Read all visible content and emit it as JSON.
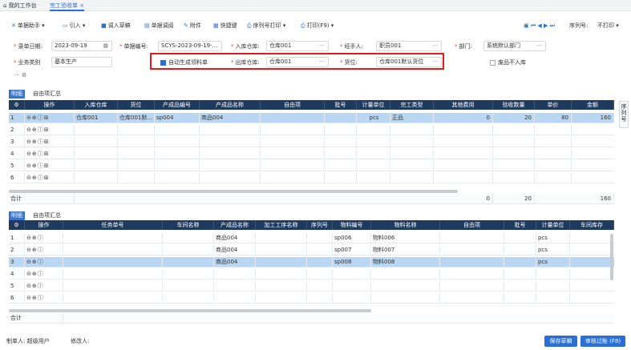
{
  "tabs": [
    {
      "label": "我的工作台"
    },
    {
      "label": "完工验收单"
    }
  ],
  "toolbar": {
    "doc_assist": "单据助手",
    "import": "引入",
    "draft": "调入草稿",
    "query": "单据调阅",
    "attach": "附件",
    "shortcut": "快捷键",
    "serial_print": "序列号打印",
    "print": "打印(F9)",
    "serial_no": "序列号:",
    "print_state": "不打印"
  },
  "form": {
    "date_label": "录单日期:",
    "date_value": "2023-09-19",
    "no_label": "单据编号:",
    "no_value": "SCYS-2023-09-19-...",
    "in_wh_label": "入库仓库:",
    "in_wh_value": "仓库001",
    "handler_label": "经手人:",
    "handler_value": "职员001",
    "dept_label": "部门:",
    "dept_value": "系统默认部门",
    "biz_label": "业务类别",
    "biz_value": "基本生产",
    "auto_label": "自动生成领料单",
    "out_wh_label": "出库仓库:",
    "out_wh_value": "仓库001",
    "pos_label": "货位:",
    "pos_value": "仓库001默认货位",
    "scrap_label": "废品不入库"
  },
  "grid1": {
    "tabs": [
      "明细",
      "自由项汇总"
    ],
    "headers": [
      "操作",
      "入库仓库",
      "货位",
      "产成品编号",
      "产成品名称",
      "自由项",
      "批号",
      "计量单位",
      "完工类型",
      "其他费用",
      "验收数量",
      "单价",
      "金额"
    ],
    "rows": [
      {
        "no": "1",
        "wh": "仓库001",
        "pos": "仓库001默...",
        "code": "sp004",
        "name": "商品004",
        "unit": "pcs",
        "type": "正品",
        "fee": "0",
        "qty": "20",
        "price": "80",
        "amt": "160"
      },
      {
        "no": "2"
      },
      {
        "no": "3"
      },
      {
        "no": "4"
      },
      {
        "no": "5"
      },
      {
        "no": "6"
      }
    ],
    "total_label": "合计",
    "total_fee": "0",
    "total_qty": "20",
    "total_amt": "160"
  },
  "grid2": {
    "tabs": [
      "明细",
      "自由项汇总"
    ],
    "headers": [
      "操作",
      "任务单号",
      "车间名称",
      "产成品名称",
      "加工工序名称",
      "序列号",
      "物料编号",
      "物料名称",
      "自由项",
      "批号",
      "计量单位",
      "车间库存"
    ],
    "rows": [
      {
        "no": "1",
        "pname": "商品004",
        "mcode": "sp006",
        "mname": "物料006",
        "unit": "pcs"
      },
      {
        "no": "2",
        "pname": "商品004",
        "mcode": "sp007",
        "mname": "物料007",
        "unit": "pcs"
      },
      {
        "no": "3",
        "pname": "商品004",
        "mcode": "sp008",
        "mname": "物料008",
        "unit": "pcs"
      },
      {
        "no": "4"
      },
      {
        "no": "5"
      },
      {
        "no": "6"
      }
    ],
    "total_label": "合计"
  },
  "footer": {
    "maker_label": "制单人:",
    "maker": "超级用户",
    "modifier_label": "修改人:",
    "save": "保存草稿",
    "audit": "审核过账 (F8)"
  },
  "side_tab": "序列号"
}
